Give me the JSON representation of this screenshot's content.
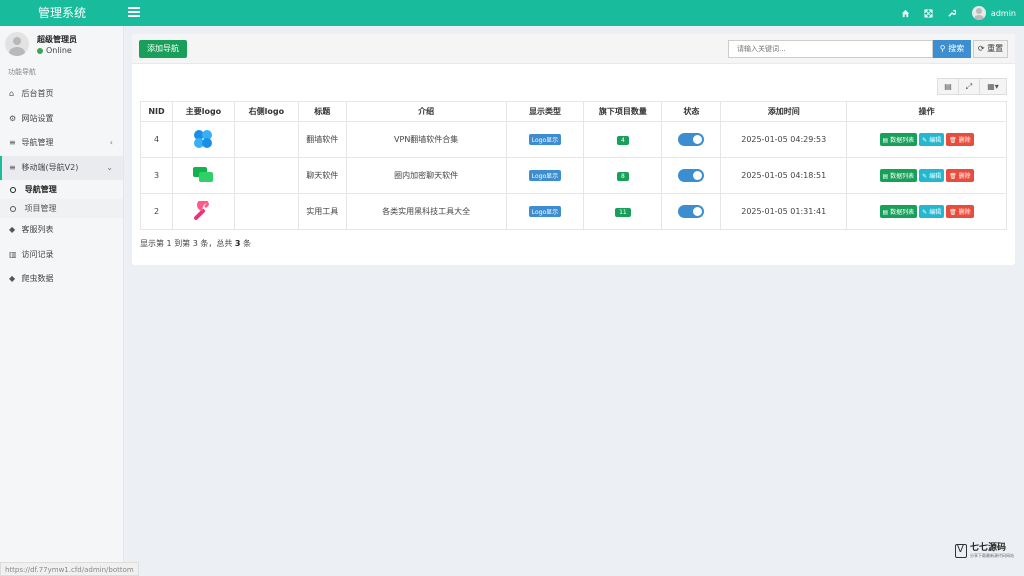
{
  "app": {
    "title": "管理系统"
  },
  "topbar": {
    "user": "admin"
  },
  "sidebar": {
    "user_name": "超级管理员",
    "status": "Online",
    "section_label": "功能导航",
    "items": [
      {
        "label": "后台首页"
      },
      {
        "label": "网站设置"
      },
      {
        "label": "导航管理"
      },
      {
        "label": "移动端(导航V2)"
      },
      {
        "label": "客服列表"
      },
      {
        "label": "访问记录"
      },
      {
        "label": "爬虫数据"
      }
    ],
    "sub_items": [
      {
        "label": "导航管理"
      },
      {
        "label": "项目管理"
      }
    ]
  },
  "toolbar": {
    "add_label": "添加导航",
    "search_placeholder": "请输入关键词...",
    "search_label": "搜索",
    "reset_label": "重置"
  },
  "table": {
    "headers": [
      "NID",
      "主要logo",
      "右侧logo",
      "标题",
      "介绍",
      "显示类型",
      "旗下项目数量",
      "状态",
      "添加时间",
      "操作"
    ],
    "rows": [
      {
        "nid": "4",
        "title": "翻墙软件",
        "intro": "VPN翻墙软件合集",
        "type": "Logo显示",
        "count": "4",
        "enabled": true,
        "time": "2025-01-05 04:29:53",
        "logo": "blue-flower"
      },
      {
        "nid": "3",
        "title": "聊天软件",
        "intro": "圈内加密聊天软件",
        "type": "Logo显示",
        "count": "8",
        "enabled": true,
        "time": "2025-01-05 04:18:51",
        "logo": "green-chat"
      },
      {
        "nid": "2",
        "title": "实用工具",
        "intro": "各类实用黑科技工具大全",
        "type": "Logo显示",
        "count": "11",
        "enabled": true,
        "time": "2025-01-05 01:31:41",
        "logo": "pink-wrench"
      }
    ],
    "actions": {
      "list": "数据列表",
      "edit": "编辑",
      "delete": "删除"
    }
  },
  "summary": {
    "prefix": "显示第",
    "from": "1",
    "mid": "到第",
    "to": "3",
    "mid2": "条，总共",
    "total": "3",
    "suffix": "条"
  },
  "status_url": "https://df.77ymw1.cfd/admin/bottom",
  "watermark": {
    "title": "七七源码",
    "subtitle": "分享下载最新源代码网站"
  },
  "colors": {
    "brand": "#18bc9c",
    "primary": "#3d8ed1",
    "success": "#18a05b",
    "danger": "#e74c3c",
    "info": "#22b8cf"
  }
}
